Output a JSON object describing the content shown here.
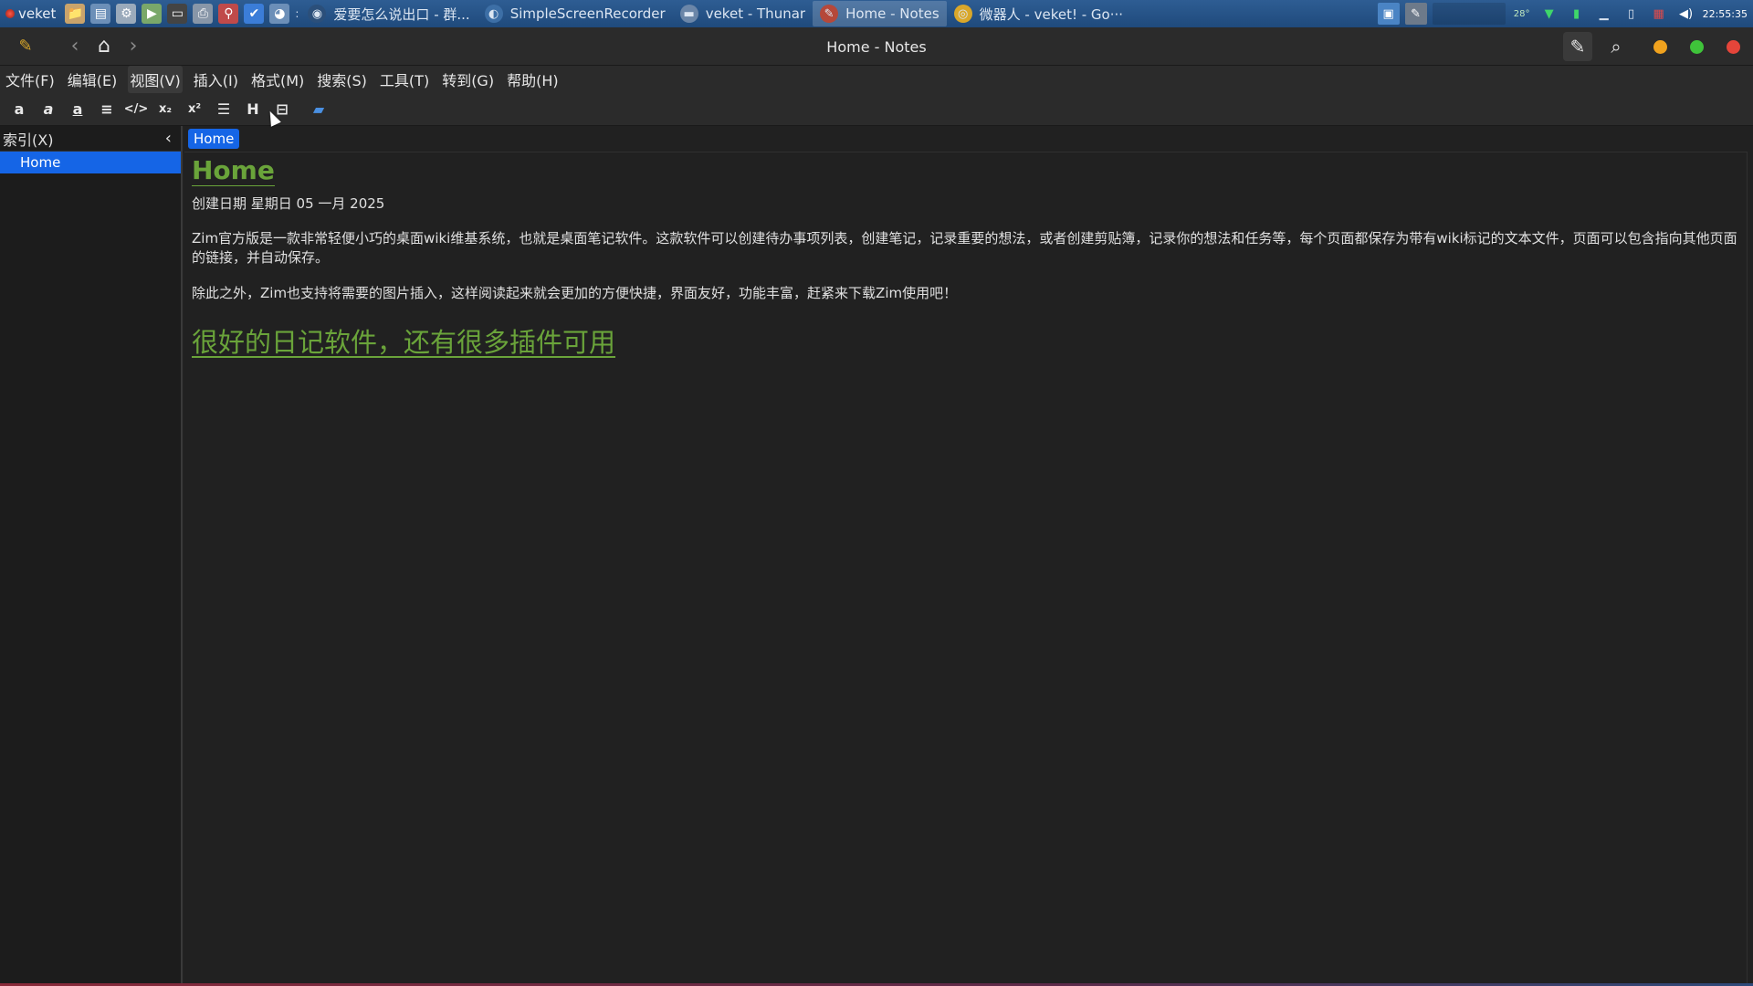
{
  "taskbar": {
    "start_label": "veket",
    "launchers": [
      {
        "name": "file-manager-launcher",
        "icon": "folder-icon",
        "glyph": "📁",
        "color": "#c9a36b"
      },
      {
        "name": "system-monitor-launcher",
        "icon": "monitor-icon",
        "glyph": "▤",
        "color": "#6c8fb8"
      },
      {
        "name": "settings-launcher",
        "icon": "gear-icon",
        "glyph": "⚙",
        "color": "#9aaabb"
      },
      {
        "name": "media-player-launcher",
        "icon": "play-icon",
        "glyph": "▶",
        "color": "#7aa86a"
      },
      {
        "name": "terminal-launcher",
        "icon": "terminal-icon",
        "glyph": "▭",
        "color": "#444"
      },
      {
        "name": "printer-launcher",
        "icon": "printer-icon",
        "glyph": "⎙",
        "color": "#8896a8"
      },
      {
        "name": "network-launcher",
        "icon": "network-icon",
        "glyph": "⚲",
        "color": "#c04a4a"
      },
      {
        "name": "checkmark-launcher",
        "icon": "check-circle-icon",
        "glyph": "✔",
        "color": "#3b7dd8"
      },
      {
        "name": "browser-launcher",
        "icon": "globe-icon",
        "glyph": "◕",
        "color": "#6c8fb8"
      }
    ],
    "separator": ":",
    "tasks": [
      {
        "label": "爱要怎么说出口 - 群...",
        "icon": "music-icon",
        "glyph": "◉",
        "color": "#2b4f7a",
        "active": false
      },
      {
        "label": "SimpleScreenRecorder",
        "icon": "recorder-icon",
        "glyph": "◐",
        "color": "#3d6fa6",
        "active": false
      },
      {
        "label": "veket - Thunar",
        "icon": "folder-icon",
        "glyph": "▬",
        "color": "#6b86a8",
        "active": false
      },
      {
        "label": "Home - Notes",
        "icon": "zim-icon",
        "glyph": "✎",
        "color": "#b5483a",
        "active": true
      },
      {
        "label": "微器人 - veket! - Go···",
        "icon": "chrome-icon",
        "glyph": "◎",
        "color": "#d9a72a",
        "active": false
      }
    ],
    "tray": {
      "clock": "22:55:35",
      "temperature": "28°"
    }
  },
  "window": {
    "title": "Home - Notes",
    "menus": [
      "文件(F)",
      "编辑(E)",
      "视图(V)",
      "插入(I)",
      "格式(M)",
      "搜索(S)",
      "工具(T)",
      "转到(G)",
      "帮助(H)"
    ],
    "hovered_menu": "视图(V)",
    "toolbar": [
      {
        "name": "bold-tool",
        "glyph": "a"
      },
      {
        "name": "italic-tool",
        "glyph": "a"
      },
      {
        "name": "underline-tool",
        "glyph": "a"
      },
      {
        "name": "strikethrough-tool",
        "glyph": "≡"
      },
      {
        "name": "code-tool",
        "glyph": "</>"
      },
      {
        "name": "subscript-tool",
        "glyph": "x₂"
      },
      {
        "name": "superscript-tool",
        "glyph": "x²"
      },
      {
        "name": "bullet-list-tool",
        "glyph": "☰"
      },
      {
        "name": "heading-tool",
        "glyph": "H"
      },
      {
        "name": "insert-box-tool",
        "glyph": "⊟"
      },
      {
        "name": "attach-folder-tool",
        "glyph": "▰"
      }
    ]
  },
  "sidebar": {
    "header": "索引(X)",
    "items": [
      {
        "label": "Home",
        "selected": true
      }
    ]
  },
  "page": {
    "breadcrumb": "Home",
    "heading": "Home",
    "created": "创建日期 星期日 05 一月 2025",
    "paragraph1": "Zim官方版是一款非常轻便小巧的桌面wiki维基系统，也就是桌面笔记软件。这款软件可以创建待办事项列表，创建笔记，记录重要的想法，或者创建剪贴簿，记录你的想法和任务等，每个页面都保存为带有wiki标记的文本文件，页面可以包含指向其他页面的链接，并自动保存。",
    "paragraph2": "除此之外，Zim也支持将需要的图片插入，这样阅读起来就会更加的方便快捷，界面友好，功能丰富，赶紧来下载Zim使用吧！",
    "link": "很好的日记软件，还有很多插件可用"
  },
  "colors": {
    "accent": "#1565e6",
    "heading_green": "#6aa43a",
    "window_close": "#e5453a",
    "window_max": "#3fc33a",
    "window_min": "#f0a21e"
  }
}
